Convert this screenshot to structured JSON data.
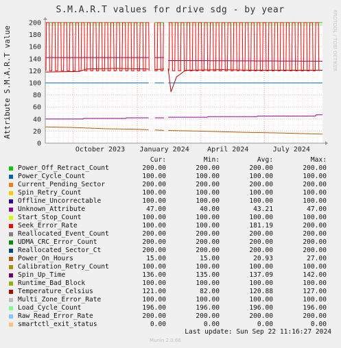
{
  "watermark": "RRDTOOL / TOBI OETIKER",
  "legend_headers": [
    "Cur:",
    "Min:",
    "Avg:",
    "Max:"
  ],
  "legend": [
    {
      "name": "Power_Off_Retract_Count",
      "color": "#00cc00",
      "cur": "200.00",
      "min": "200.00",
      "avg": "200.00",
      "max": "200.00"
    },
    {
      "name": "Power_Cycle_Count",
      "color": "#0066b3",
      "cur": "100.00",
      "min": "100.00",
      "avg": "100.00",
      "max": "100.00"
    },
    {
      "name": "Current_Pending_Sector",
      "color": "#ff8000",
      "cur": "200.00",
      "min": "200.00",
      "avg": "200.00",
      "max": "200.00"
    },
    {
      "name": "Spin_Retry_Count",
      "color": "#ffcc00",
      "cur": "100.00",
      "min": "100.00",
      "avg": "100.00",
      "max": "100.00"
    },
    {
      "name": "Offline_Uncorrectable",
      "color": "#330099",
      "cur": "100.00",
      "min": "100.00",
      "avg": "100.00",
      "max": "100.00"
    },
    {
      "name": "Unknown_Attribute",
      "color": "#990099",
      "cur": "47.00",
      "min": "40.00",
      "avg": "43.21",
      "max": "47.00"
    },
    {
      "name": "Start_Stop_Count",
      "color": "#ccff00",
      "cur": "100.00",
      "min": "100.00",
      "avg": "100.00",
      "max": "100.00"
    },
    {
      "name": "Seek_Error_Rate",
      "color": "#ff0000",
      "cur": "100.00",
      "min": "100.00",
      "avg": "181.19",
      "max": "200.00"
    },
    {
      "name": "Reallocated_Event_Count",
      "color": "#808080",
      "cur": "200.00",
      "min": "200.00",
      "avg": "200.00",
      "max": "200.00"
    },
    {
      "name": "UDMA_CRC_Error_Count",
      "color": "#008f00",
      "cur": "200.00",
      "min": "200.00",
      "avg": "200.00",
      "max": "200.00"
    },
    {
      "name": "Reallocated_Sector_Ct",
      "color": "#00487d",
      "cur": "200.00",
      "min": "200.00",
      "avg": "200.00",
      "max": "200.00"
    },
    {
      "name": "Power_On_Hours",
      "color": "#b35a00",
      "cur": "15.00",
      "min": "15.00",
      "avg": "20.93",
      "max": "27.00"
    },
    {
      "name": "Calibration_Retry_Count",
      "color": "#b38f00",
      "cur": "100.00",
      "min": "100.00",
      "avg": "100.00",
      "max": "100.00"
    },
    {
      "name": "Spin_Up_Time",
      "color": "#6b006b",
      "cur": "136.00",
      "min": "135.00",
      "avg": "137.09",
      "max": "142.00"
    },
    {
      "name": "Runtime_Bad_Block",
      "color": "#8fb300",
      "cur": "100.00",
      "min": "100.00",
      "avg": "100.00",
      "max": "100.00"
    },
    {
      "name": "Temperature_Celsius",
      "color": "#b30000",
      "cur": "121.00",
      "min": "82.00",
      "avg": "120.88",
      "max": "127.00"
    },
    {
      "name": "Multi_Zone_Error_Rate",
      "color": "#bebebe",
      "cur": "100.00",
      "min": "100.00",
      "avg": "100.00",
      "max": "100.00"
    },
    {
      "name": "Load_Cycle_Count",
      "color": "#80ff80",
      "cur": "196.00",
      "min": "196.00",
      "avg": "196.00",
      "max": "196.00"
    },
    {
      "name": "Raw_Read_Error_Rate",
      "color": "#80c9ff",
      "cur": "200.00",
      "min": "200.00",
      "avg": "200.00",
      "max": "200.00"
    },
    {
      "name": "smartctl_exit_status",
      "color": "#ffc080",
      "cur": "0.00",
      "min": "0.00",
      "avg": "0.00",
      "max": "0.00"
    }
  ],
  "last_update": "Last update: Sun Sep 22 11:16:27 2024",
  "footer": "Munin 2.0.66",
  "chart_data": {
    "type": "line",
    "title": "S.M.A.R.T values for drive sdg - by year",
    "ylabel": "Attribute S.M.A.R.T value",
    "xlabel": "",
    "ylim": [
      0,
      200
    ],
    "yticks": [
      0,
      20,
      40,
      60,
      80,
      100,
      120,
      140,
      160,
      180,
      200
    ],
    "xrange": [
      "2023-08-22",
      "2024-09-22"
    ],
    "xticks": [
      {
        "date": "2023-10-01",
        "label": "October 2023"
      },
      {
        "date": "2024-01-01",
        "label": "January 2024"
      },
      {
        "date": "2024-04-01",
        "label": "April 2024"
      },
      {
        "date": "2024-07-01",
        "label": "July 2024"
      }
    ],
    "grid": true,
    "gaps": [
      {
        "start": "2024-01-18",
        "end": "2024-01-25"
      },
      {
        "start": "2024-02-09",
        "end": "2024-02-13"
      }
    ],
    "series": [
      {
        "name": "Seek_Error_Rate",
        "color": "#ff0000",
        "base": 120,
        "peak": 200,
        "spikes": 47
      },
      {
        "name": "Spin_Up_Time",
        "color": "#6b006b",
        "points": [
          [
            "2023-08-22",
            142
          ],
          [
            "2024-02-13",
            142
          ],
          [
            "2024-02-13",
            137
          ],
          [
            "2024-09-22",
            136
          ]
        ]
      },
      {
        "name": "Temperature_Celsius",
        "color": "#b30000",
        "points": [
          [
            "2023-08-22",
            118
          ],
          [
            "2023-10-10",
            119
          ],
          [
            "2023-10-20",
            123
          ],
          [
            "2023-12-01",
            124
          ],
          [
            "2024-01-15",
            123
          ],
          [
            "2024-01-25",
            122
          ],
          [
            "2024-02-08",
            123
          ],
          [
            "2024-02-14",
            124
          ],
          [
            "2024-02-18",
            85
          ],
          [
            "2024-02-26",
            110
          ],
          [
            "2024-03-10",
            121
          ],
          [
            "2024-05-01",
            122
          ],
          [
            "2024-06-15",
            121
          ],
          [
            "2024-09-22",
            121
          ]
        ]
      },
      {
        "name": "Power_Cycle_Count",
        "color": "#0066b3",
        "points": [
          [
            "2023-08-22",
            100
          ],
          [
            "2024-09-22",
            100
          ]
        ]
      },
      {
        "name": "Unknown_Attribute",
        "color": "#990099",
        "points": [
          [
            "2023-08-22",
            40
          ],
          [
            "2023-10-15",
            40
          ],
          [
            "2023-10-15",
            41
          ],
          [
            "2023-12-15",
            41
          ],
          [
            "2023-12-15",
            42
          ],
          [
            "2024-02-10",
            42
          ],
          [
            "2024-02-10",
            43
          ],
          [
            "2024-04-10",
            43
          ],
          [
            "2024-04-10",
            44
          ],
          [
            "2024-06-20",
            44
          ],
          [
            "2024-06-20",
            45
          ],
          [
            "2024-09-12",
            45
          ],
          [
            "2024-09-12",
            47
          ],
          [
            "2024-09-22",
            47
          ]
        ]
      },
      {
        "name": "Power_On_Hours",
        "color": "#b35a00",
        "points": [
          [
            "2023-08-22",
            27
          ],
          [
            "2023-10-01",
            26
          ],
          [
            "2023-11-15",
            24
          ],
          [
            "2024-01-01",
            23
          ],
          [
            "2024-02-13",
            21
          ],
          [
            "2024-04-01",
            20
          ],
          [
            "2024-06-01",
            18
          ],
          [
            "2024-07-20",
            17
          ],
          [
            "2024-09-22",
            15
          ]
        ]
      },
      {
        "name": "Power_Off_Retract_Count",
        "color": "#00cc00",
        "points": [
          [
            "2023-08-22",
            200
          ],
          [
            "2024-09-22",
            200
          ]
        ]
      },
      {
        "name": "Load_Cycle_Count",
        "color": "#80ff80",
        "points": [
          [
            "2023-08-22",
            196
          ],
          [
            "2024-09-22",
            196
          ]
        ]
      },
      {
        "name": "smartctl_exit_status",
        "color": "#ffc080",
        "points": [
          [
            "2023-08-22",
            0
          ],
          [
            "2024-09-22",
            0
          ]
        ]
      }
    ]
  }
}
